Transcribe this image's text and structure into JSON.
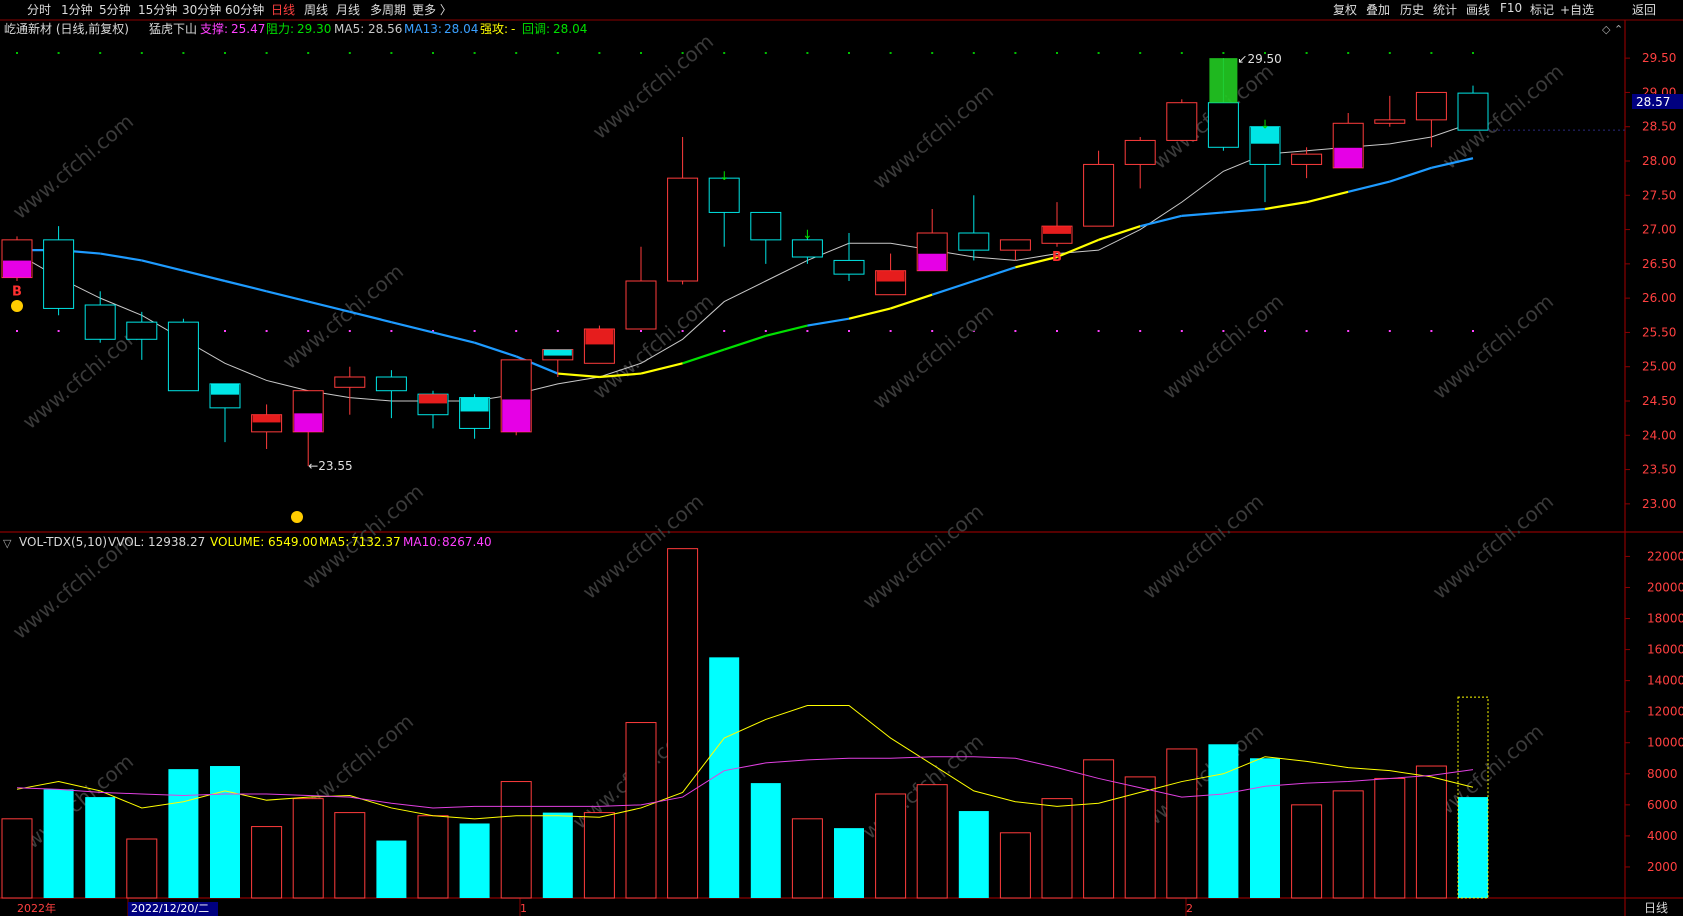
{
  "toolbar": {
    "left_items": [
      "分时",
      "1分钟",
      "5分钟",
      "15分钟",
      "30分钟",
      "60分钟",
      "日线",
      "周线",
      "月线",
      "多周期",
      "更多 〉"
    ],
    "active_index": 6,
    "right_items": [
      "复权",
      "叠加",
      "历史",
      "统计",
      "画线",
      "F10",
      "标记",
      "+自选",
      "返回"
    ]
  },
  "price_header": {
    "title": "屹通新材 (日线,前复权)",
    "indicator_name": "猛虎下山",
    "support_label": "支撑:",
    "support_value": "25.47",
    "resist_label": "阻力:",
    "resist_value": "29.30",
    "ma5_label": "MA5:",
    "ma5_value": "28.56",
    "ma13_label": "MA13:",
    "ma13_value": "28.04",
    "strong_label": "强攻:",
    "strong_value": "-",
    "pullback_label": "回调:",
    "pullback_value": "28.04"
  },
  "volume_header": {
    "name": "VOL-TDX(5,10)",
    "vvol_label": "VVOL:",
    "vvol_value": "12938.27",
    "volume_label": "VOLUME:",
    "volume_value": "6549.00",
    "ma5_label": "MA5:",
    "ma5_value": "7132.37",
    "ma10_label": "MA10:",
    "ma10_value": "8267.40"
  },
  "last_price_tag": "28.57",
  "bottom_axis": {
    "year_label": "2022年",
    "cursor_date": "2022/12/20/二",
    "month_marks": [
      "1",
      "2"
    ],
    "period_label": "日线"
  },
  "colors": {
    "up": "#ff3c3c",
    "down": "#00e5e5",
    "ma5": "#c8c8c8",
    "ma13_blue": "#1e9bff",
    "ma13_yellow": "#ffff00",
    "ma13_green": "#00e000",
    "vol_ma5": "#ffff00",
    "vol_ma10": "#e040e0",
    "grid": "#8a0000",
    "magenta": "#ff00ff",
    "cyan_bright": "#00ffff"
  },
  "chart_data": [
    {
      "type": "candlestick",
      "title": "屹通新材 (日线,前复权)",
      "y_ticks": [
        23.0,
        23.5,
        24.0,
        24.5,
        25.0,
        25.5,
        26.0,
        26.5,
        27.0,
        27.5,
        28.0,
        28.5,
        29.0,
        29.5
      ],
      "ylim": [
        22.75,
        29.75
      ],
      "candles": [
        {
          "o": 26.3,
          "h": 26.9,
          "l": 26.25,
          "c": 26.85,
          "hl": "magenta"
        },
        {
          "o": 26.85,
          "h": 27.05,
          "l": 25.75,
          "c": 25.85
        },
        {
          "o": 25.9,
          "h": 26.1,
          "l": 25.35,
          "c": 25.4
        },
        {
          "o": 25.65,
          "h": 25.8,
          "l": 25.1,
          "c": 25.4
        },
        {
          "o": 25.65,
          "h": 25.7,
          "l": 24.65,
          "c": 24.65
        },
        {
          "o": 24.75,
          "h": 24.75,
          "l": 23.9,
          "c": 24.4,
          "hl": "cyan"
        },
        {
          "o": 24.05,
          "h": 24.45,
          "l": 23.8,
          "c": 24.3,
          "hl": "red"
        },
        {
          "o": 24.05,
          "h": 24.65,
          "l": 23.55,
          "c": 24.65,
          "hl": "magenta"
        },
        {
          "o": 24.7,
          "h": 25.0,
          "l": 24.3,
          "c": 24.85
        },
        {
          "o": 24.85,
          "h": 24.95,
          "l": 24.25,
          "c": 24.65
        },
        {
          "o": 24.6,
          "h": 24.65,
          "l": 24.1,
          "c": 24.3,
          "hl": "red"
        },
        {
          "o": 24.55,
          "h": 24.6,
          "l": 23.95,
          "c": 24.1,
          "hl": "cyan"
        },
        {
          "o": 24.05,
          "h": 25.1,
          "l": 24.0,
          "c": 25.1,
          "hl": "magenta"
        },
        {
          "o": 25.1,
          "h": 25.25,
          "l": 24.85,
          "c": 25.25,
          "hl": "cyan"
        },
        {
          "o": 25.05,
          "h": 25.6,
          "l": 25.05,
          "c": 25.55,
          "hl": "red"
        },
        {
          "o": 25.55,
          "h": 26.75,
          "l": 25.55,
          "c": 26.25
        },
        {
          "o": 26.25,
          "h": 28.35,
          "l": 26.2,
          "c": 27.75
        },
        {
          "o": 27.75,
          "h": 27.75,
          "l": 26.75,
          "c": 27.25
        },
        {
          "o": 27.25,
          "h": 27.25,
          "l": 26.5,
          "c": 26.85
        },
        {
          "o": 26.85,
          "h": 26.9,
          "l": 26.5,
          "c": 26.6
        },
        {
          "o": 26.55,
          "h": 26.95,
          "l": 26.25,
          "c": 26.35
        },
        {
          "o": 26.05,
          "h": 26.65,
          "l": 26.05,
          "c": 26.4,
          "hl": "red"
        },
        {
          "o": 26.4,
          "h": 27.3,
          "l": 26.4,
          "c": 26.95,
          "hl": "magenta"
        },
        {
          "o": 26.95,
          "h": 27.5,
          "l": 26.55,
          "c": 26.7
        },
        {
          "o": 26.7,
          "h": 26.85,
          "l": 26.55,
          "c": 26.85
        },
        {
          "o": 26.8,
          "h": 27.4,
          "l": 26.75,
          "c": 27.05,
          "hl": "red"
        },
        {
          "o": 27.05,
          "h": 28.15,
          "l": 27.05,
          "c": 27.95
        },
        {
          "o": 27.95,
          "h": 28.35,
          "l": 27.6,
          "c": 28.3
        },
        {
          "o": 28.3,
          "h": 28.9,
          "l": 28.3,
          "c": 28.85
        },
        {
          "o": 28.85,
          "h": 29.5,
          "l": 28.15,
          "c": 28.2,
          "hl": "green"
        },
        {
          "o": 28.5,
          "h": 28.5,
          "l": 27.4,
          "c": 27.95,
          "hl": "cyan"
        },
        {
          "o": 27.95,
          "h": 28.2,
          "l": 27.75,
          "c": 28.1
        },
        {
          "o": 27.9,
          "h": 28.7,
          "l": 27.9,
          "c": 28.55,
          "hl": "magenta"
        },
        {
          "o": 28.55,
          "h": 28.95,
          "l": 28.5,
          "c": 28.6
        },
        {
          "o": 28.6,
          "h": 29.0,
          "l": 28.2,
          "c": 29.0
        },
        {
          "o": 28.99,
          "h": 29.1,
          "l": 28.45,
          "c": 28.45
        }
      ],
      "ma5": [
        26.65,
        26.3,
        26.0,
        25.75,
        25.4,
        25.05,
        24.8,
        24.65,
        24.55,
        24.5,
        24.5,
        24.5,
        24.6,
        24.75,
        24.85,
        25.05,
        25.4,
        25.95,
        26.25,
        26.55,
        26.8,
        26.8,
        26.7,
        26.6,
        26.55,
        26.65,
        26.7,
        27.0,
        27.4,
        27.85,
        28.1,
        28.15,
        28.2,
        28.25,
        28.35,
        28.56
      ],
      "ma13": [
        26.7,
        26.7,
        26.65,
        26.55,
        26.4,
        26.25,
        26.1,
        25.95,
        25.8,
        25.65,
        25.5,
        25.35,
        25.15,
        24.9,
        24.85,
        24.9,
        25.05,
        25.25,
        25.45,
        25.6,
        25.7,
        25.85,
        26.05,
        26.25,
        26.45,
        26.6,
        26.85,
        27.05,
        27.2,
        27.25,
        27.3,
        27.4,
        27.55,
        27.7,
        27.9,
        28.04
      ],
      "ma13_color": [
        "b",
        "b",
        "b",
        "b",
        "b",
        "b",
        "b",
        "b",
        "b",
        "b",
        "b",
        "b",
        "b",
        "b",
        "y",
        "y",
        "y",
        "g",
        "g",
        "g",
        "b",
        "y",
        "y",
        "b",
        "b",
        "y",
        "y",
        "y",
        "b",
        "b",
        "b",
        "y",
        "y",
        "b",
        "b",
        "b"
      ],
      "annotations": [
        {
          "text": "29.50",
          "candle": 29,
          "price": 29.5
        },
        {
          "text": "23.55",
          "candle": 7,
          "price": 23.55
        },
        {
          "text": "B",
          "candle": 0,
          "price": 26.1
        },
        {
          "text": "B",
          "candle": 25,
          "price": 26.6
        }
      ]
    },
    {
      "type": "bar",
      "title": "VOL-TDX(5,10)",
      "y_ticks": [
        2000,
        4000,
        6000,
        8000,
        10000,
        12000,
        14000,
        16000,
        18000,
        20000,
        22000
      ],
      "ylim": [
        0,
        22800
      ],
      "volumes": [
        5100,
        7000,
        6500,
        3800,
        8300,
        8500,
        4600,
        6400,
        5500,
        3700,
        5300,
        4800,
        7500,
        5500,
        5500,
        11300,
        22500,
        15500,
        7400,
        5100,
        4500,
        6700,
        7300,
        5600,
        4200,
        6400,
        8900,
        7800,
        9600,
        9900,
        9000,
        6000,
        6900,
        7700,
        8500,
        6500
      ],
      "vol_up": [
        true,
        false,
        false,
        true,
        false,
        false,
        true,
        true,
        true,
        false,
        true,
        false,
        true,
        false,
        true,
        true,
        true,
        false,
        false,
        true,
        false,
        true,
        true,
        false,
        true,
        true,
        true,
        true,
        true,
        false,
        false,
        true,
        true,
        true,
        true,
        false
      ],
      "vvol": 12938.27,
      "ma5": [
        7000,
        7500,
        6900,
        5800,
        6200,
        6900,
        6300,
        6500,
        6600,
        5800,
        5300,
        5100,
        5300,
        5300,
        5200,
        5800,
        6800,
        10300,
        11500,
        12400,
        12400,
        10300,
        8600,
        6900,
        6200,
        5900,
        6100,
        6800,
        7500,
        8000,
        9100,
        8800,
        8400,
        8200,
        7800,
        7132.37
      ],
      "ma10": [
        7100,
        7000,
        6800,
        6700,
        6600,
        6700,
        6700,
        6600,
        6500,
        6100,
        5800,
        5900,
        5900,
        5900,
        5900,
        6000,
        6500,
        8200,
        8700,
        8900,
        9000,
        9000,
        9100,
        9100,
        9000,
        8400,
        7700,
        7100,
        6500,
        6700,
        7200,
        7400,
        7500,
        7700,
        7900,
        8267.4
      ]
    }
  ]
}
